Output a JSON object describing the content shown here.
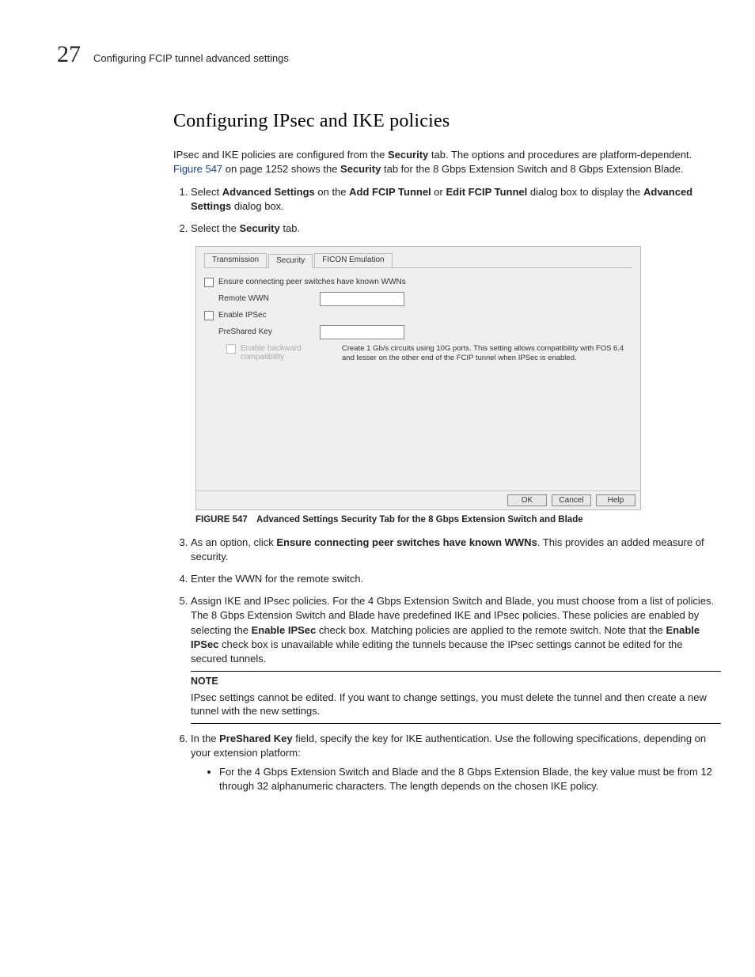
{
  "header": {
    "chapter_number": "27",
    "chapter_title": "Configuring FCIP tunnel advanced settings"
  },
  "section_title": "Configuring IPsec and IKE policies",
  "intro": {
    "p1_a": "IPsec and IKE policies are configured from the ",
    "p1_b": " tab. The options and procedures are platform-dependent. ",
    "p1_c": " on page 1252 shows the ",
    "p1_d": " tab for the 8 Gbps Extension Switch and 8 Gbps Extension Blade.",
    "security": "Security",
    "figure_link": "Figure 547"
  },
  "steps_top": {
    "s1_a": "Select ",
    "s1_b": " on the ",
    "s1_c": " or ",
    "s1_d": " dialog box to display the ",
    "s1_e": " dialog box.",
    "s1_adv": "Advanced Settings",
    "s1_add": "Add FCIP Tunnel",
    "s1_edit": "Edit FCIP Tunnel",
    "s2_a": "Select the ",
    "s2_b": " tab.",
    "s2_sec": "Security"
  },
  "dialog": {
    "tabs": [
      "Transmission",
      "Security",
      "FICON Emulation"
    ],
    "ensure_label": "Ensure connecting peer switches have known WWNs",
    "remote_wwn_label": "Remote WWN",
    "enable_ipsec_label": "Enable IPSec",
    "preshared_label": "PreShared Key",
    "backcompat_label": "Enable backward compatibility",
    "backcompat_hint": "Create 1 Gb/s circuits using 10G ports. This setting allows compatibility with FOS 6.4 and lesser on the other end of the FCIP tunnel when IPSec is enabled.",
    "buttons": {
      "ok": "OK",
      "cancel": "Cancel",
      "help": "Help"
    }
  },
  "figure_caption": {
    "label": "FIGURE 547",
    "text": "Advanced Settings Security Tab for the 8 Gbps Extension Switch and Blade"
  },
  "steps_bottom": {
    "s3_a": "As an option, click ",
    "s3_b": ". This provides an added measure of security.",
    "s3_opt": "Ensure connecting peer switches have known WWNs",
    "s4": "Enter the WWN for the remote switch.",
    "s5_a": "Assign IKE and IPsec policies. For the 4 Gbps Extension Switch and Blade, you must choose from a list of policies. The 8 Gbps Extension Switch and Blade have predefined IKE and IPsec policies. These policies are enabled by selecting the ",
    "s5_b": " check box. Matching policies are applied to the remote switch. Note that the ",
    "s5_c": " check box is unavailable while editing the tunnels because the IPsec settings cannot be edited for the secured tunnels.",
    "s5_enable": "Enable IPSec",
    "s6_a": "In the ",
    "s6_b": " field, specify the key for IKE authentication. Use the following specifications, depending on your extension platform:",
    "s6_key": "PreShared Key",
    "s6_bullet": "For the 4 Gbps Extension Switch and Blade and the 8 Gbps Extension Blade, the key value must be from 12 through 32 alphanumeric characters. The length depends on the chosen IKE policy."
  },
  "note": {
    "head": "NOTE",
    "body": "IPsec settings cannot be edited. If you want to change settings, you must delete the tunnel and then create a new tunnel with the new settings."
  }
}
